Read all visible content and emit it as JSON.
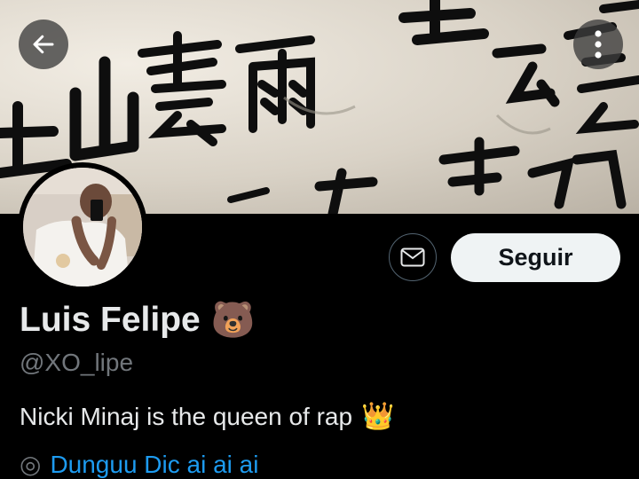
{
  "header": {
    "back_icon": "arrow-left-icon",
    "more_icon": "more-vertical-icon"
  },
  "profile": {
    "display_name": "Luis Felipe",
    "name_emoji": "🐻",
    "handle": "@XO_lipe",
    "bio": "Nicki Minaj is the queen of rap",
    "bio_emoji": "👑",
    "partial_line": "Dunguu Dic ai ai ai"
  },
  "actions": {
    "message_icon": "mail-icon",
    "follow_label": "Seguir"
  },
  "colors": {
    "background": "#000000",
    "follow_button_bg": "#eff3f4",
    "follow_button_text": "#0f1419",
    "handle_gray": "#71767b",
    "link_blue": "#1d9bf0"
  }
}
